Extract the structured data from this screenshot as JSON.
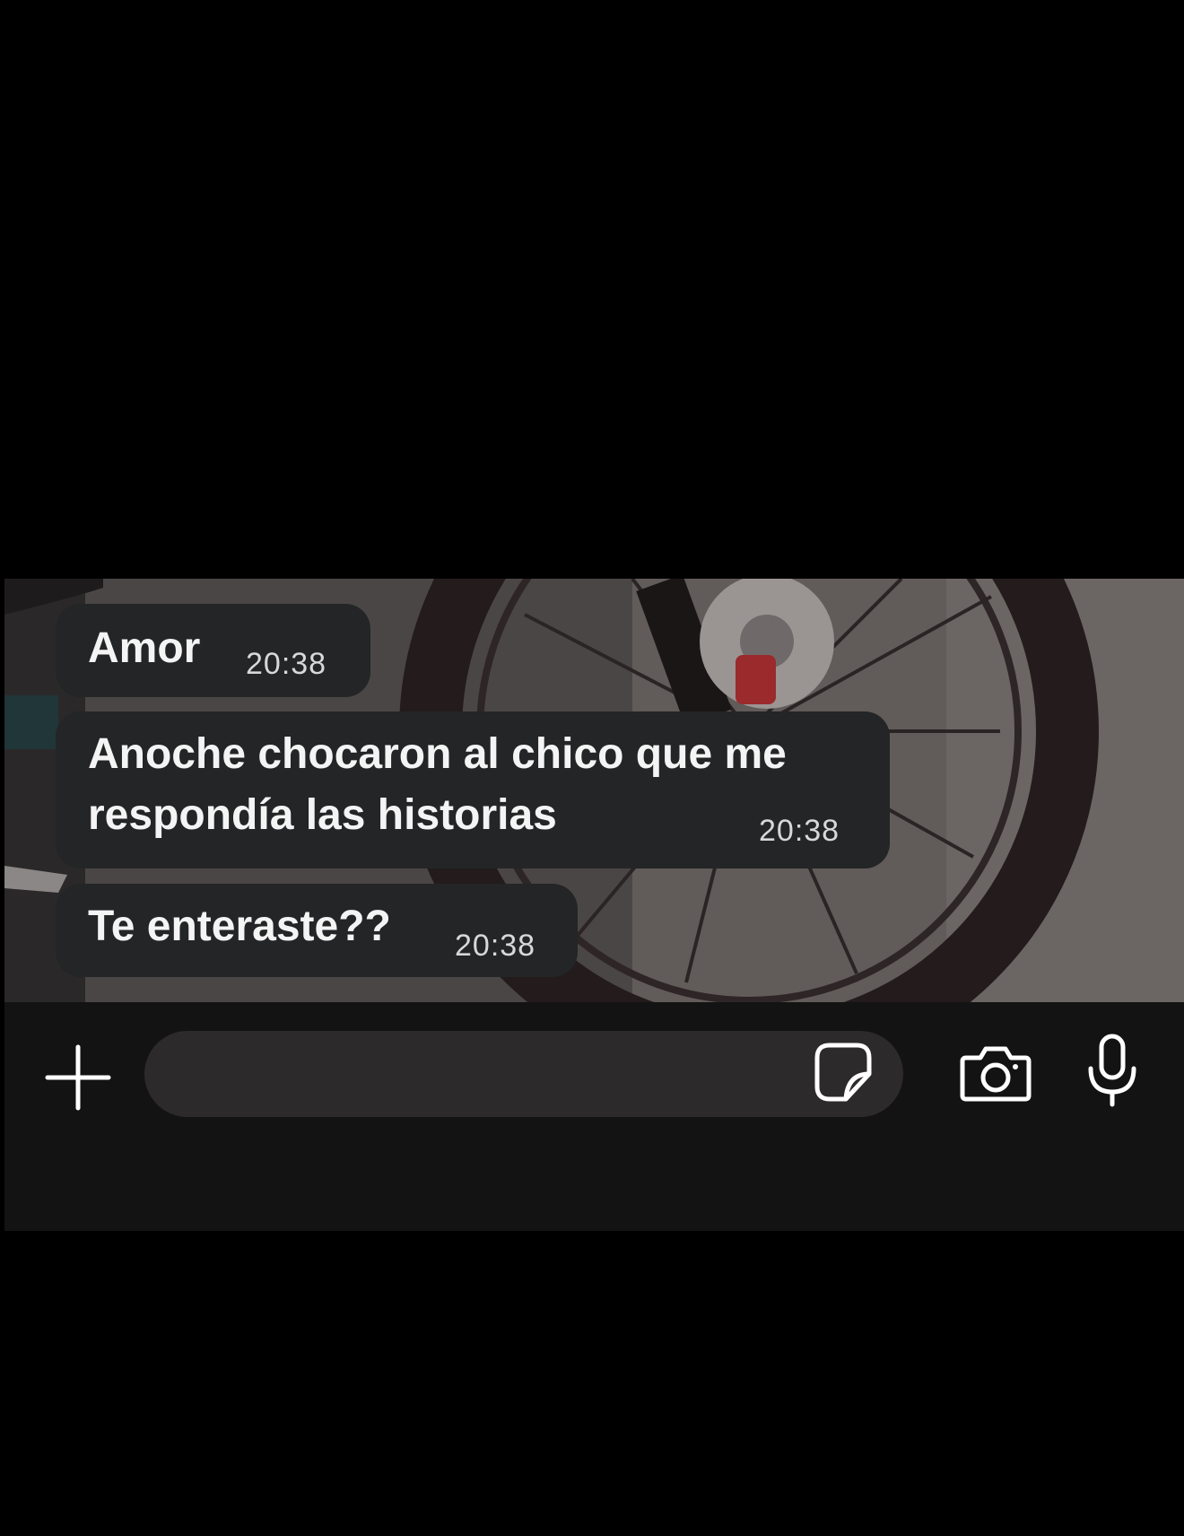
{
  "chat": {
    "messages": [
      {
        "text": "Amor",
        "time": "20:38"
      },
      {
        "text": "Anoche chocaron al chico que me\nrespondía las historias",
        "time": "20:38"
      },
      {
        "text": "Te enteraste??",
        "time": "20:38"
      }
    ]
  },
  "composer": {
    "input_value": "",
    "icons": [
      "plus-icon",
      "sticker-icon",
      "camera-icon",
      "microphone-icon"
    ]
  },
  "colors": {
    "bubble": "#232526",
    "composer_bg": "#141314",
    "input_bg": "#2c2a2b",
    "text": "#f4f4f4",
    "time": "#d8d8d8"
  }
}
